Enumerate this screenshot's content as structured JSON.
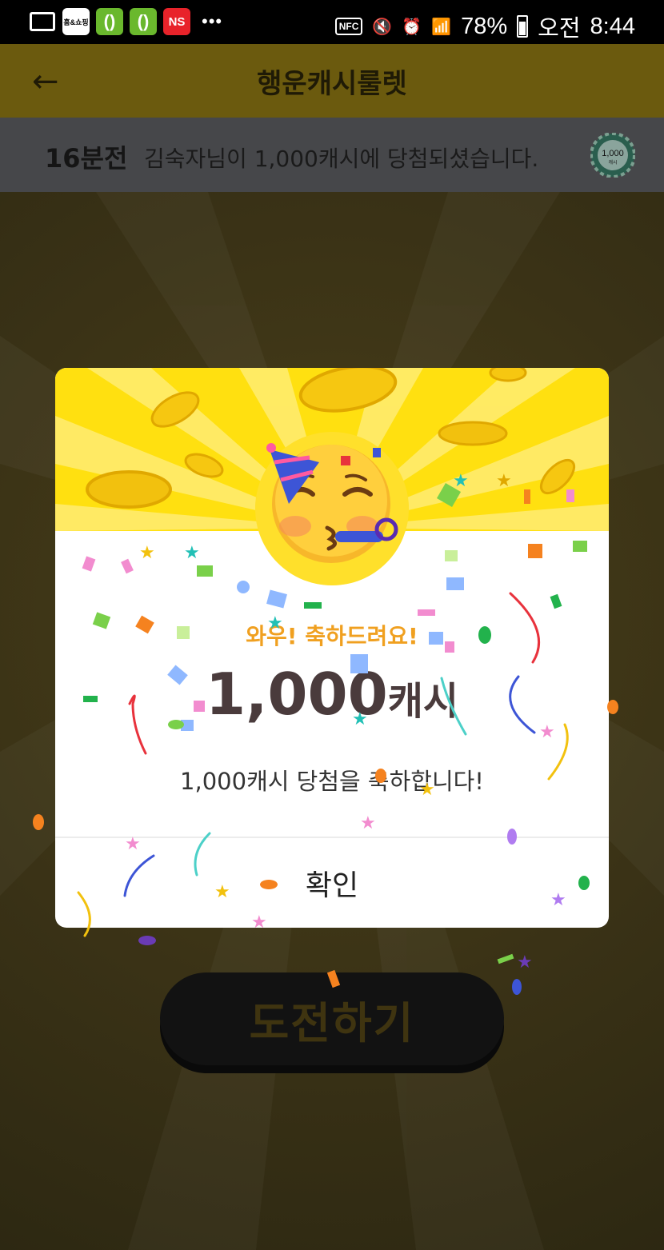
{
  "status_bar": {
    "left_icons": [
      "card-icon",
      "shop-icon",
      "app-icon",
      "app-icon",
      "ns-icon",
      "more-icon"
    ],
    "shop_label": "홈&쇼핑",
    "ns_label": "NS",
    "more_label": "•••",
    "nfc_label": "NFC",
    "battery": "78%",
    "ampm": "오전",
    "time": "8:44"
  },
  "app_bar": {
    "back_icon": "arrow-left-icon",
    "title": "행운캐시룰렛"
  },
  "ticker": {
    "time_ago": "16분전",
    "message": "김숙자님이 1,000캐시에 당첨되셨습니다.",
    "coin_label": "1,000",
    "coin_sub": "캐시"
  },
  "challenge_button": "도전하기",
  "dialog": {
    "emoji": "party-face-icon",
    "subtitle": "와우! 축하드려요!",
    "amount": "1,000",
    "amount_unit": "캐시",
    "description": "1,000캐시 당첨을 축하합니다!",
    "confirm": "확인"
  },
  "colors": {
    "accent_yellow": "#ffe010",
    "subtitle_orange": "#f0a020",
    "amount_text": "#4a3b3c",
    "dim_bar": "#6b5a0e"
  }
}
